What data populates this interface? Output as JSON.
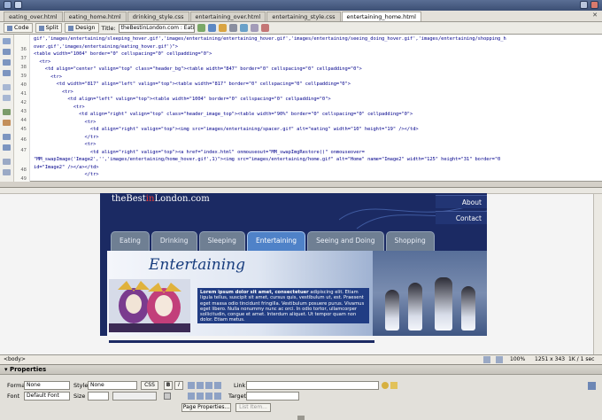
{
  "doc_tabs": [
    "eating_over.html",
    "eating_home.html",
    "drinking_style.css",
    "entertaining_over.html",
    "entertaining_style.css",
    "entertaining_home.html"
  ],
  "active_tab_index": 5,
  "toolbar": {
    "code_label": "Code",
    "split_label": "Split",
    "design_label": "Design",
    "title_label": "Title:",
    "title_value": "theBestinLondon.com : Eating"
  },
  "code": {
    "line_numbers": [
      "36",
      "37",
      "38",
      "39",
      "40",
      "41",
      "42",
      "43",
      "44",
      "45",
      "46",
      "47",
      "",
      "48",
      "49"
    ],
    "lines": [
      "gif','images/entertaining/sleeping_hover.gif','images/entertaining/entertaining_hover.gif','images/entertaining/seeing_doing_hover.gif','images/entertaining/shopping_h",
      "over.gif','images/entertaining/eating_hover.gif')\">",
      "<table width=\"1004\" border=\"0\" cellspacing=\"0\" cellpadding=\"0\">",
      "  <tr>",
      "    <td align=\"center\" valign=\"top\" class=\"header_bg\"><table width=\"847\" border=\"0\" cellspacing=\"0\" cellpadding=\"0\">",
      "      <tr>",
      "        <td width=\"817\" align=\"left\" valign=\"top\"><table width=\"817\" border=\"0\" cellspacing=\"0\" cellpadding=\"0\">",
      "          <tr>",
      "            <td align=\"left\" valign=\"top\"><table width=\"1004\" border=\"0\" cellspacing=\"0\" cellpadding=\"0\">",
      "              <tr>",
      "                <td align=\"right\" valign=\"top\" class=\"header_image_top\"><table width=\"90%\" border=\"0\" cellspacing=\"0\" cellpadding=\"0\">",
      "                  <tr>",
      "                    <td align=\"right\" valign=\"top\"><img src=\"images/entertaining/spacer.gif\" alt=\"eating\" width=\"10\" height=\"19\" /></td>",
      "                  </tr>",
      "                  <tr>",
      "                    <td align=\"right\" valign=\"top\"><a href=\"index.html\" onmouseout=\"MM_swapImgRestore()\" onmouseover=",
      "\"MM_swapImage('Image2','','images/entertaining/home_hover.gif',1)\"><img src=\"images/entertaining/home.gif\" alt=\"Home\" name=\"Image2\" width=\"125\" height=\"31\" border=\"0",
      "id=\"Image2\" /></a></td>",
      "                  </tr>"
    ]
  },
  "site": {
    "logo_pre": "theBest",
    "logo_accent": "in",
    "logo_post": "London.com",
    "side_links": [
      "About",
      "Contact"
    ],
    "nav": [
      "Eating",
      "Drinking",
      "Sleeping",
      "Entertaining",
      "Seeing and Doing",
      "Shopping"
    ],
    "active_nav_index": 3,
    "banner_title": "Entertaining",
    "blurb_bold": "Lorem ipsum dolor sit amet, consectetuer",
    "blurb_rest": " adipiscing elit. Etiam ligula tellus, suscipit sit amet, cursus quis, vestibulum ut, est. Praesent eget massa odio tincidunt fringilla. Vestibulum posuere purus. Vivamus eget libero. Nulla nonummy nunc ac orci. In odio tortor, ullamcorper sollicitudin, congue et amet. Interdum aliquet. Ut tempor quam non dolor. Etiam metus."
  },
  "statusbar": {
    "tag": "<body>",
    "zoom": "100%",
    "size": "1251 x 343",
    "file": "1K / 1 sec"
  },
  "properties": {
    "header": "Properties",
    "format_label": "Format",
    "format_value": "None",
    "style_label": "Style",
    "style_value": "None",
    "css_button": "CSS",
    "bold": "B",
    "italic": "I",
    "link_label": "Link",
    "font_label": "Font",
    "font_value": "Default Font",
    "size_label": "Size",
    "size_value": "",
    "target_label": "Target",
    "page_properties": "Page Properties...",
    "list_item": "List Item..."
  },
  "colors": {
    "site_bg": "#1b2a63",
    "nav_active": "#4f82c8",
    "code_text": "#00008b"
  }
}
